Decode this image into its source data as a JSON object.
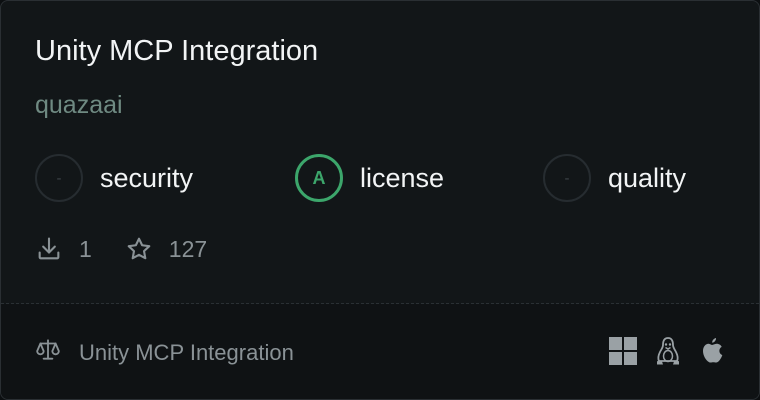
{
  "card": {
    "title": "Unity MCP Integration",
    "author": "quazaai"
  },
  "scores": [
    {
      "grade": "-",
      "label": "security",
      "graded": false
    },
    {
      "grade": "A",
      "label": "license",
      "graded": true
    },
    {
      "grade": "-",
      "label": "quality",
      "graded": false
    }
  ],
  "stats": {
    "downloads": "1",
    "downloads_icon": "download-icon",
    "stars": "127",
    "stars_icon": "star-icon"
  },
  "footer": {
    "name": "Unity MCP Integration",
    "license_icon": "scale-icon",
    "platforms": [
      "windows-icon",
      "linux-icon",
      "apple-icon"
    ]
  },
  "colors": {
    "grade_a": "#3ca66b",
    "author": "#6f8a82",
    "background": "#121618"
  }
}
